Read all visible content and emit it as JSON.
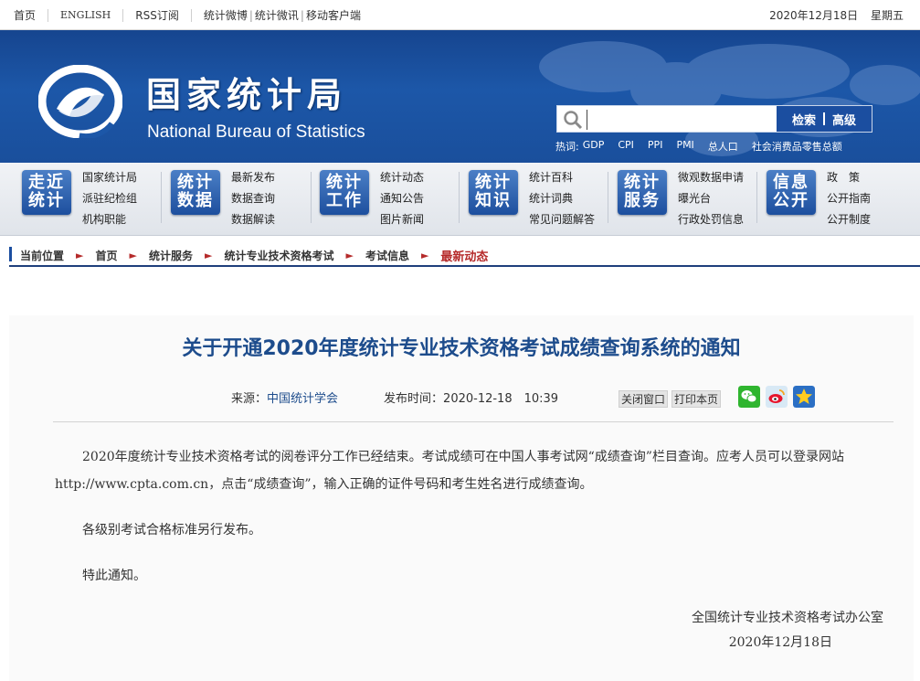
{
  "topbar": {
    "links": [
      "首页",
      "ENGLISH",
      "RSS订阅",
      "统计微博",
      "统计微讯",
      "移动客户端"
    ],
    "date": "2020年12月18日",
    "weekday": "星期五"
  },
  "banner": {
    "cn_title": "国家统计局",
    "en_title": "National Bureau of Statistics",
    "search_placeholder": "",
    "search_button": "检索",
    "advanced_button": "高级",
    "hot_label": "热词:",
    "hot_words": [
      "GDP",
      "CPI",
      "PPI",
      "PMI",
      "总人口",
      "社会消费品零售总额"
    ]
  },
  "nav": [
    {
      "tile_line1": "走近",
      "tile_line2": "统计",
      "items": [
        "国家统计局",
        "派驻纪检组",
        "机构职能"
      ]
    },
    {
      "tile_line1": "统计",
      "tile_line2": "数据",
      "items": [
        "最新发布",
        "数据查询",
        "数据解读"
      ]
    },
    {
      "tile_line1": "统计",
      "tile_line2": "工作",
      "items": [
        "统计动态",
        "通知公告",
        "图片新闻"
      ]
    },
    {
      "tile_line1": "统计",
      "tile_line2": "知识",
      "items": [
        "统计百科",
        "统计词典",
        "常见问题解答"
      ]
    },
    {
      "tile_line1": "统计",
      "tile_line2": "服务",
      "items": [
        "微观数据申请",
        "曝光台",
        "行政处罚信息"
      ]
    },
    {
      "tile_line1": "信息",
      "tile_line2": "公开",
      "items": [
        "政　策",
        "公开指南",
        "公开制度"
      ]
    }
  ],
  "breadcrumb": {
    "label": "当前位置",
    "items": [
      "首页",
      "统计服务",
      "统计专业技术资格考试",
      "考试信息"
    ],
    "current": "最新动态",
    "arrow": "►"
  },
  "article": {
    "title": "关于开通2020年度统计专业技术资格考试成绩查询系统的通知",
    "source_label": "来源：",
    "source": "中国统计学会",
    "time_label": "发布时间：",
    "time": "2020-12-18　10:39",
    "close_window": "关闭窗口",
    "print_page": "打印本页",
    "paragraphs": [
      "2020年度统计专业技术资格考试的阅卷评分工作已经结束。考试成绩可在中国人事考试网“成绩查询”栏目查询。应考人员可以登录网站http://www.cpta.com.cn，点击“成绩查询”，输入正确的证件号码和考生姓名进行成绩查询。",
      "各级别考试合格标准另行发布。",
      "特此通知。"
    ],
    "signature_org": "全国统计专业技术资格考试办公室",
    "signature_date": "2020年12月18日"
  },
  "icons": {
    "search": "search-icon",
    "share": [
      "wechat-icon",
      "weibo-icon",
      "favorite-star-icon"
    ]
  },
  "colors": {
    "banner_blue": "#1c57a8",
    "title_blue": "#1d4c8c",
    "accent_red": "#b52a2a"
  }
}
